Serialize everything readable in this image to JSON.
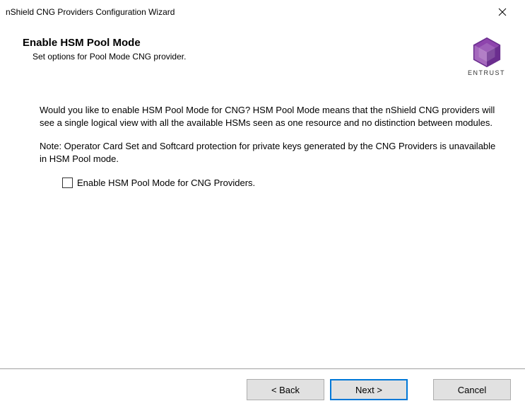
{
  "window": {
    "title": "nShield CNG Providers Configuration Wizard"
  },
  "header": {
    "title": "Enable HSM Pool Mode",
    "subtitle": "Set options for Pool Mode CNG provider.",
    "brand": "ENTRUST"
  },
  "content": {
    "paragraph1": "Would you like to enable HSM Pool Mode for CNG? HSM Pool Mode means that the nShield CNG providers will see a single logical view with all the available HSMs seen as one resource and no distinction between modules.",
    "paragraph2": "Note: Operator Card Set and Softcard protection for private keys generated by the CNG Providers is unavailable in HSM Pool mode.",
    "checkbox_label": "Enable HSM Pool Mode for CNG Providers."
  },
  "footer": {
    "back": "< Back",
    "next": "Next >",
    "cancel": "Cancel"
  }
}
